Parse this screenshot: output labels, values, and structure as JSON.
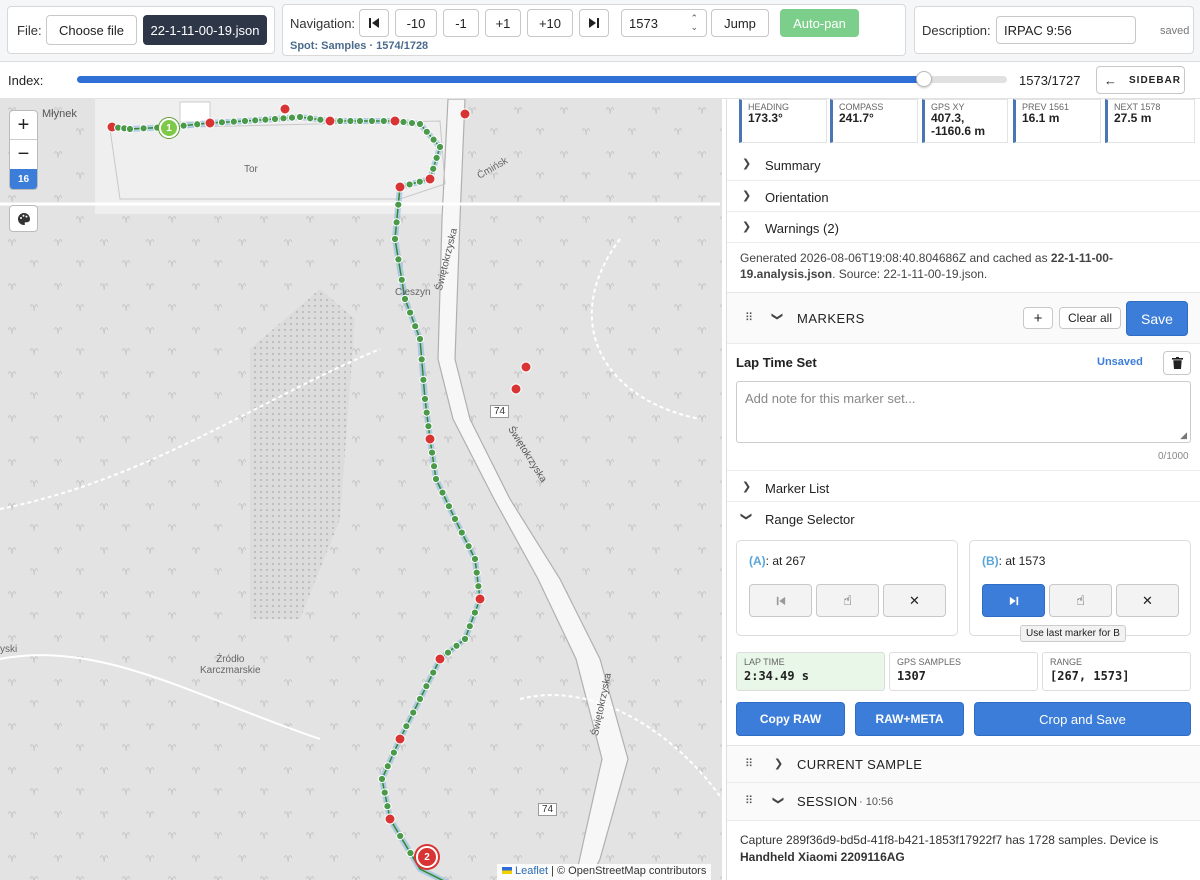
{
  "file": {
    "label": "File:",
    "choose": "Choose file",
    "filename": "22-1-11-00-19.json"
  },
  "nav": {
    "label": "Navigation:",
    "b_m10": "-10",
    "b_m1": "-1",
    "b_p1": "+1",
    "b_p10": "+10",
    "input_value": "1573",
    "jump": "Jump",
    "autopan": "Auto-pan",
    "spot": "Spot: Samples · 1574/1728"
  },
  "desc": {
    "label": "Description:",
    "value": "IRPAC 9:56",
    "status": "saved"
  },
  "index": {
    "label": "Index:",
    "counter": "1573/1727",
    "progress": 0.9107,
    "sidebar": "SIDEBAR"
  },
  "map": {
    "zoom": "16",
    "labels": {
      "mlynek": "Młynek",
      "tor": "Tor",
      "cminsk": "Ćmińsk",
      "cieszyn": "Cieszyn",
      "swietokrzyska_a": "Świętokrzyska",
      "swietokrzyska_b": "Świętokrzyska",
      "swietokrzyska_c": "Świętokrzyska",
      "road74a": "74",
      "road74b": "74",
      "zrodlo": "Źródło\nKarczmarskie",
      "yski": "yski"
    },
    "markers": {
      "m1": "1",
      "m2": "2"
    },
    "attr_leaflet": "Leaflet",
    "attr_osm": " | © OpenStreetMap contributors"
  },
  "metrics": [
    {
      "k": "HEADING",
      "v": "173.3°"
    },
    {
      "k": "COMPASS",
      "v": "241.7°"
    },
    {
      "k": "GPS XY",
      "v": "407.3,\n-1160.6 m"
    },
    {
      "k": "PREV 1561",
      "v": "16.1 m"
    },
    {
      "k": "NEXT 1578",
      "v": "27.5 m"
    }
  ],
  "sections": {
    "summary": "Summary",
    "orientation": "Orientation",
    "warnings": "Warnings (2)"
  },
  "generated": {
    "pre": "Generated 2026-08-06T19:08:40.804686Z and cached as ",
    "file": "22-1-11-00-19.analysis.json",
    "post": ". Source: 22-1-11-00-19.json."
  },
  "markers": {
    "title": "MARKERS",
    "add": "+",
    "clear": "Clear all",
    "save": "Save",
    "set_name": "Lap Time Set",
    "unsaved": "Unsaved",
    "note_placeholder": "Add note for this marker set...",
    "note_count": "0/1000",
    "list": "Marker List",
    "range": "Range Selector"
  },
  "range": {
    "a_label": "(A)",
    "a_text": ": at 267",
    "b_label": "(B)",
    "b_text": ": at 1573",
    "tooltip": "Use last marker for B"
  },
  "stats": [
    {
      "k": "LAP TIME",
      "v": "2:34.49 s"
    },
    {
      "k": "GPS SAMPLES",
      "v": "1307"
    },
    {
      "k": "RANGE",
      "v": "[267, 1573]"
    }
  ],
  "actions": {
    "copy": "Copy RAW",
    "rawmeta": "RAW+META",
    "crop": "Crop and Save"
  },
  "current": {
    "title": "CURRENT SAMPLE"
  },
  "session": {
    "title": "SESSION",
    "time": "· 10:56",
    "text_pre": "Capture 289f36d9-bd5d-41f8-b421-1853f17922f7 has 1728 samples. Device is ",
    "device": "Handheld Xiaomi 2209116AG"
  },
  "colors": {
    "accent": "#3b7dd8",
    "track": "#4a9a4a",
    "stop": "#d83434",
    "lap_bg": "#e8f7e8"
  }
}
